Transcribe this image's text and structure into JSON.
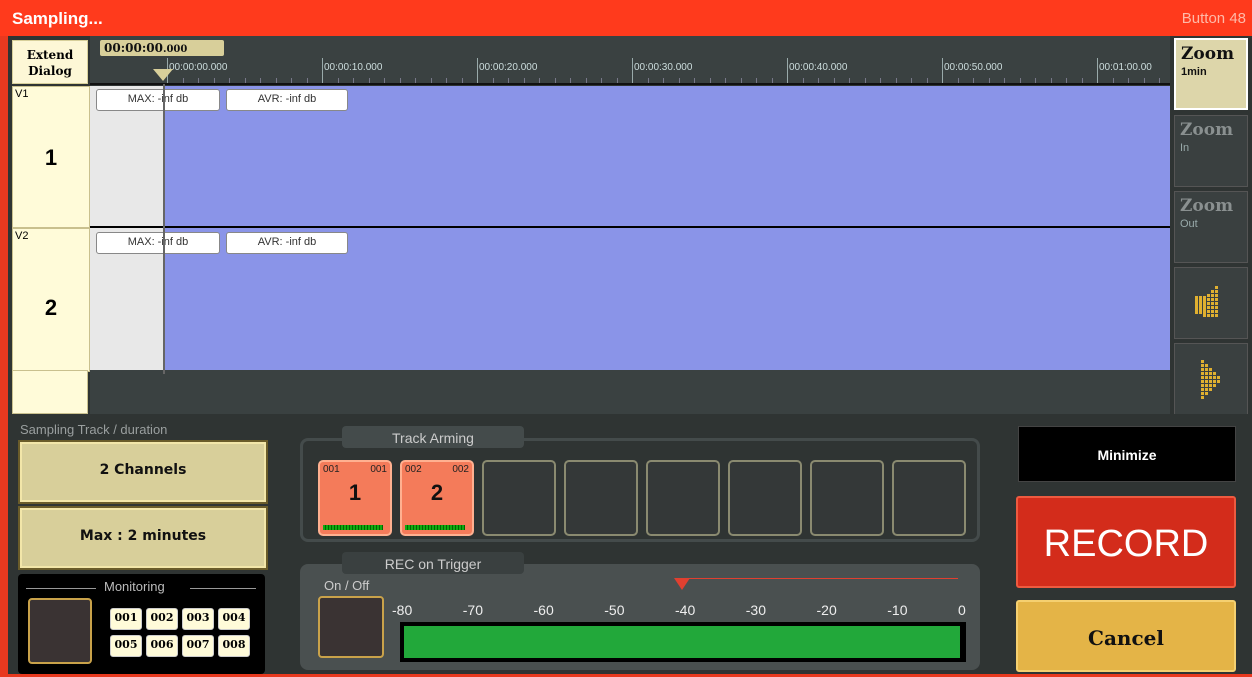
{
  "window": {
    "title": "Sampling...",
    "button_label": "Button 48"
  },
  "toolbar": {
    "extend_dialog_line1": "Extend",
    "extend_dialog_line2": "Dialog"
  },
  "timeline": {
    "current_time": "00:00:00",
    "current_time_ms": ".000",
    "ruler_labels": [
      "00:00:00.000",
      "00:00:10.000",
      "00:00:20.000",
      "00:00:30.000",
      "00:00:40.000",
      "00:00:50.000",
      "00:01:00.00"
    ]
  },
  "tracks": [
    {
      "label": "V1",
      "number": "1",
      "max": "MAX: -inf db",
      "avr": "AVR: -inf db"
    },
    {
      "label": "V2",
      "number": "2",
      "max": "MAX: -inf db",
      "avr": "AVR: -inf db"
    }
  ],
  "zoom": [
    {
      "title": "Zoom",
      "sub": "1min"
    },
    {
      "title": "Zoom",
      "sub": "In"
    },
    {
      "title": "Zoom",
      "sub": "Out"
    }
  ],
  "sampling": {
    "section_label": "Sampling Track / duration",
    "channels_button": "2 Channels",
    "duration_button": "Max : 2 minutes"
  },
  "monitoring": {
    "label": "Monitoring",
    "buttons": [
      "001",
      "002",
      "003",
      "004",
      "005",
      "006",
      "007",
      "008"
    ]
  },
  "track_arming": {
    "label": "Track Arming",
    "armed": [
      {
        "top_left": "001",
        "top_right": "001",
        "number": "1"
      },
      {
        "top_left": "002",
        "top_right": "002",
        "number": "2"
      }
    ]
  },
  "trigger": {
    "label": "REC on Trigger",
    "on_off": "On / Off",
    "scale": [
      "-80",
      "-70",
      "-60",
      "-50",
      "-40",
      "-30",
      "-20",
      "-10",
      "0"
    ],
    "threshold_db": -40,
    "level_fraction": 1.0
  },
  "actions": {
    "minimize": "Minimize",
    "record": "RECORD",
    "cancel": "Cancel"
  },
  "colors": {
    "title_bar": "#ff3a1c",
    "lane": "#8a94e8",
    "record": "#d32c1b",
    "cancel": "#e4b447",
    "meter": "#22a83a"
  },
  "icons": {
    "scroll_left": "dotted-arrow-left-icon",
    "scroll_right": "dotted-arrow-right-icon"
  }
}
